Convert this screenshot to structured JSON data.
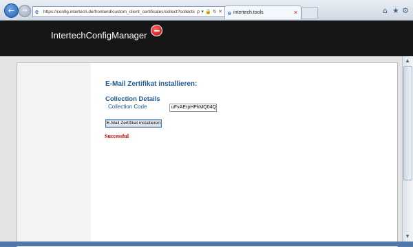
{
  "browser": {
    "back_label": "←",
    "forward_label": "→",
    "url": "https://config.intertech.de/frontend/custom_client_certificates/collect?collectionCode=",
    "address_icons": "ρ ▾ 🔒 ↻ ✕",
    "tab_title": "intertech.tools",
    "tab_close": "✕",
    "toolbar_icons": {
      "home": "⌂",
      "favorites": "★",
      "tools": "⚙"
    }
  },
  "header": {
    "app_title": "IntertechConfigManager"
  },
  "main": {
    "heading": "E-Mail Zertifikat installieren:",
    "section_title": "Collection Details",
    "collection_code_label": "Collection Code",
    "collection_code_value": "uFvAErpHPkMQ04Q",
    "install_button": "E-Mail Zertifikat installieren",
    "status": "Successful"
  },
  "scrollbar": {
    "up": "▲",
    "down": "▼"
  },
  "colors": {
    "heading": "#1f5a96",
    "status": "#d00000",
    "header_bg": "#161616"
  }
}
